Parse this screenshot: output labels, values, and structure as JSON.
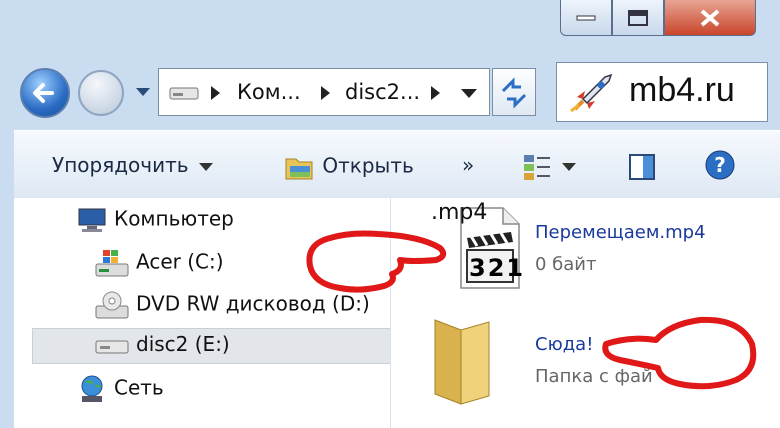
{
  "window": {
    "address": {
      "crumbs": [
        "Ком...",
        "disc2..."
      ]
    },
    "brand": {
      "logo_text": "mb4.ru"
    }
  },
  "toolbar": {
    "organize_label": "Упорядочить",
    "open_label": "Открыть",
    "more_label": "»"
  },
  "nav": {
    "items": [
      {
        "label": "Компьютер",
        "icon": "computer-icon"
      },
      {
        "label": "Acer (C:)",
        "icon": "hard-drive-icon"
      },
      {
        "label": "DVD RW дисковод (D:)",
        "icon": "dvd-drive-icon"
      },
      {
        "label": "disc2 (E:)",
        "icon": "usb-drive-icon",
        "selected": true
      },
      {
        "label": "Сеть",
        "icon": "network-icon"
      }
    ]
  },
  "content": {
    "files": [
      {
        "name": "Перемещаем.mp4",
        "sub": "0 байт",
        "icon_ext": ".mp4",
        "icon_digits": "321"
      },
      {
        "name": "Сюда!",
        "sub": "Папка с фай"
      }
    ]
  },
  "colors": {
    "annotation": "#e01818",
    "link": "#1a3a9c"
  }
}
